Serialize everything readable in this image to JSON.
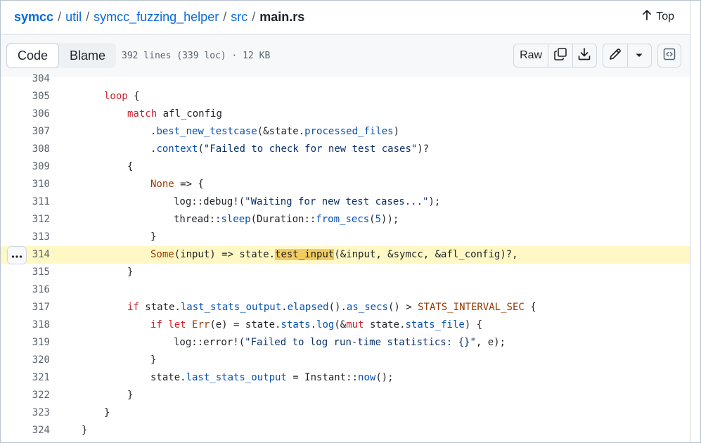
{
  "breadcrumb": {
    "repo": "symcc",
    "parts": [
      "util",
      "symcc_fuzzing_helper",
      "src"
    ],
    "file": "main.rs",
    "sep": "/"
  },
  "top_link": "Top",
  "toolbar": {
    "code_tab": "Code",
    "blame_tab": "Blame",
    "file_meta": "392 lines (339 loc) · 12 KB",
    "raw_label": "Raw"
  },
  "icons": {
    "arrow_up": "arrow-up-icon",
    "copy": "copy-icon",
    "download": "download-icon",
    "pencil": "pencil-icon",
    "caret": "triangle-down-icon",
    "symbols": "code-square-icon",
    "kebab": "kebab-horizontal-icon"
  },
  "colors": {
    "link": "#0969da",
    "keyword": "#cf222e",
    "highlight_line": "#fff8c5",
    "highlight_token": "#f2cc60"
  },
  "code": {
    "highlighted_line": "314",
    "line_numbers": [
      "304",
      "305",
      "306",
      "307",
      "308",
      "309",
      "310",
      "311",
      "312",
      "313",
      "314",
      "315",
      "316",
      "317",
      "318",
      "319",
      "320",
      "321",
      "322",
      "323",
      "324"
    ],
    "lines": [
      [],
      [
        [
          "kw",
          "loop"
        ],
        [
          "",
          "{"
        ]
      ],
      [
        [
          "kw",
          "match"
        ],
        [
          "",
          " afl_config"
        ]
      ],
      [
        [
          "",
          "."
        ],
        [
          "fn",
          "best_new_testcase"
        ],
        [
          "",
          "(&state."
        ],
        [
          "fld",
          "processed_files"
        ],
        [
          "",
          ")"
        ]
      ],
      [
        [
          "",
          "."
        ],
        [
          "fn",
          "context"
        ],
        [
          "",
          "("
        ],
        [
          "str",
          "\"Failed to check for new test cases\""
        ],
        [
          "",
          ")?"
        ]
      ],
      [
        [
          "",
          "{"
        ]
      ],
      [
        [
          "cst",
          "None"
        ],
        [
          "",
          " => {"
        ]
      ],
      [
        [
          "",
          "log::debug!("
        ],
        [
          "str",
          "\"Waiting for new test cases...\""
        ],
        [
          "",
          ");"
        ]
      ],
      [
        [
          "",
          "thread::"
        ],
        [
          "fn",
          "sleep"
        ],
        [
          "",
          "(Duration::"
        ],
        [
          "fn",
          "from_secs"
        ],
        [
          "",
          "("
        ],
        [
          "num",
          "5"
        ],
        [
          "",
          "));"
        ]
      ],
      [
        [
          "",
          "}"
        ]
      ],
      [
        [
          "cst",
          "Some"
        ],
        [
          "",
          "(input) => state."
        ],
        [
          "mark",
          "test_input"
        ],
        [
          "",
          "(&input, &symcc, &afl_config)?,"
        ]
      ],
      [
        [
          "",
          "}"
        ]
      ],
      [],
      [
        [
          "kw",
          "if"
        ],
        [
          "",
          " state."
        ],
        [
          "fld",
          "last_stats_output"
        ],
        [
          "",
          "."
        ],
        [
          "fn",
          "elapsed"
        ],
        [
          "",
          "()."
        ],
        [
          "fn",
          "as_secs"
        ],
        [
          "",
          "() > "
        ],
        [
          "cst",
          "STATS_INTERVAL_SEC"
        ],
        [
          "",
          " {"
        ]
      ],
      [
        [
          "kw",
          "if let"
        ],
        [
          "",
          " "
        ],
        [
          "cst",
          "Err"
        ],
        [
          "",
          "(e) = state."
        ],
        [
          "fld",
          "stats"
        ],
        [
          "",
          "."
        ],
        [
          "fn",
          "log"
        ],
        [
          "",
          "(&"
        ],
        [
          "kw",
          "mut"
        ],
        [
          "",
          " state."
        ],
        [
          "fld",
          "stats_file"
        ],
        [
          "",
          ") {"
        ]
      ],
      [
        [
          "",
          "log::error!("
        ],
        [
          "str",
          "\"Failed to log run-time statistics: {}\""
        ],
        [
          "",
          ", e);"
        ]
      ],
      [
        [
          "",
          "}"
        ]
      ],
      [
        [
          "",
          "state."
        ],
        [
          "fld",
          "last_stats_output"
        ],
        [
          "",
          " = Instant::"
        ],
        [
          "fn",
          "now"
        ],
        [
          "",
          "();"
        ]
      ],
      [
        [
          "",
          "}"
        ]
      ],
      [
        [
          "",
          "}"
        ]
      ],
      [
        [
          "",
          "}"
        ]
      ]
    ]
  }
}
